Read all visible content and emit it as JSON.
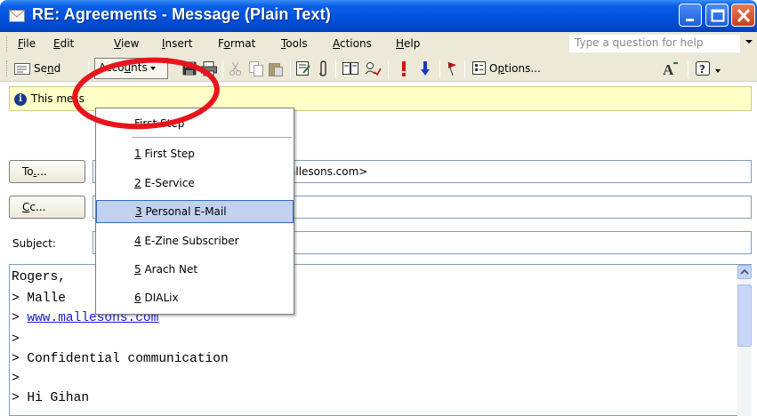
{
  "window": {
    "title": "RE: Agreements - Message (Plain Text)"
  },
  "menubar": {
    "items": [
      {
        "label": "File",
        "mnemonic": "F",
        "rest": "ile"
      },
      {
        "label": "Edit",
        "mnemonic": "E",
        "rest": "dit"
      },
      {
        "label": "View",
        "mnemonic": "V",
        "rest": "iew"
      },
      {
        "label": "Insert",
        "mnemonic": "I",
        "rest": "nsert"
      },
      {
        "label": "Format",
        "mnemonic_pre": "F",
        "mnemonic": "o",
        "rest": "rmat"
      },
      {
        "label": "Tools",
        "mnemonic": "T",
        "rest": "ools"
      },
      {
        "label": "Actions",
        "mnemonic": "A",
        "rest": "ctions"
      },
      {
        "label": "Help",
        "mnemonic": "H",
        "rest": "elp"
      }
    ],
    "help_placeholder": "Type a question for help"
  },
  "toolbar": {
    "send_label_pre": "Se",
    "send_label_u": "n",
    "send_label_post": "d",
    "accounts_pre": "Acco",
    "accounts_u": "u",
    "accounts_post": "nts",
    "options_pre": "O",
    "options_u": "p",
    "options_post": "tions..."
  },
  "infobar": {
    "text": "This mess"
  },
  "header": {
    "to_label_pre": "To",
    "to_label_u": "",
    "to_label_post": "...",
    "to_value": "allesons.com>",
    "cc_label_pre": "",
    "cc_label_u": "C",
    "cc_label_post": "c...",
    "cc_value": "",
    "subject_label": "Subject:",
    "subject_value": ""
  },
  "accounts_menu": {
    "header": "First Step",
    "items": [
      {
        "num": "1",
        "label": " First Step"
      },
      {
        "num": "2",
        "label": " E-Service"
      },
      {
        "num": "3",
        "label": " Personal E-Mail",
        "selected": true
      },
      {
        "num": "4",
        "label": " E-Zine Subscriber"
      },
      {
        "num": "5",
        "label": " Arach Net"
      },
      {
        "num": "6",
        "label": " DIALix"
      }
    ]
  },
  "body": {
    "lines": [
      "Rogers,",
      "> Malle",
      "> ",
      ">",
      "> Confidential communication",
      ">",
      "> Hi Gihan"
    ],
    "link_text": "www.mallesons.com"
  },
  "colors": {
    "title_bar": "#0053e0",
    "menu_bg": "#ece9d8",
    "info_bg": "#ffffc6",
    "selection": "#c1d2ee",
    "annotation": "#e8141c"
  }
}
